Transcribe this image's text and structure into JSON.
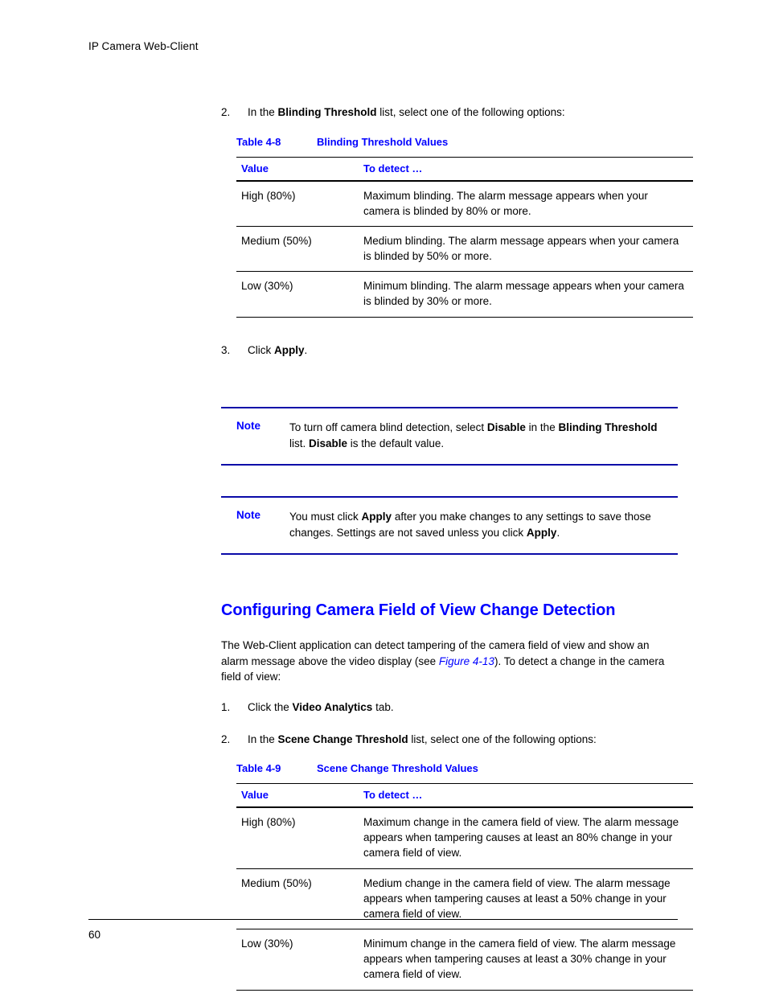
{
  "header": {
    "running_title": "IP Camera Web-Client"
  },
  "steps_top": {
    "step2_num": "2.",
    "step2_pre": "In the ",
    "step2_bold": "Blinding Threshold",
    "step2_post": " list, select one of the following options:",
    "step3_num": "3.",
    "step3_pre": "Click ",
    "step3_bold": "Apply",
    "step3_post": "."
  },
  "table_48": {
    "caption_number": "Table 4-8",
    "caption_title": "Blinding Threshold Values",
    "headers": [
      "Value",
      "To detect …"
    ],
    "rows": [
      {
        "value": "High (80%)",
        "detect": "Maximum blinding. The alarm message appears when your camera is blinded by 80% or more."
      },
      {
        "value": "Medium (50%)",
        "detect": "Medium blinding. The alarm message appears when your camera is blinded by 50% or more."
      },
      {
        "value": "Low (30%)",
        "detect": "Minimum blinding. The alarm message appears when your camera is blinded by 30% or more."
      }
    ]
  },
  "note1": {
    "label": "Note",
    "t1": "To turn off camera blind detection, select ",
    "b1": "Disable",
    "t2": " in the ",
    "b2": "Blinding Threshold",
    "t3": " list. ",
    "b3": "Disable",
    "t4": " is the default value."
  },
  "note2": {
    "label": "Note",
    "t1": "You must click ",
    "b1": "Apply",
    "t2": " after you make changes to any settings to save those changes. Settings are not saved unless you click ",
    "b2": "Apply",
    "t3": "."
  },
  "section": {
    "heading": "Configuring Camera Field of View Change Detection",
    "para_pre": "The Web-Client application can detect tampering of the camera field of view and show an alarm message above the video display (see ",
    "para_xref": "Figure 4-13",
    "para_post": "). To detect a change in the camera field of view:"
  },
  "steps_bottom": {
    "step1_num": "1.",
    "step1_pre": "Click the ",
    "step1_bold": "Video Analytics",
    "step1_post": " tab.",
    "step2_num": "2.",
    "step2_pre": "In the ",
    "step2_bold": "Scene Change Threshold",
    "step2_post": " list, select one of the following options:"
  },
  "table_49": {
    "caption_number": "Table 4-9",
    "caption_title": "Scene Change Threshold Values",
    "headers": [
      "Value",
      "To detect …"
    ],
    "rows": [
      {
        "value": "High (80%)",
        "detect": "Maximum change in the camera field of view. The alarm message appears when tampering causes at least an 80% change in your camera field of view."
      },
      {
        "value": "Medium (50%)",
        "detect": "Medium change in the camera field of view. The alarm message appears when tampering causes at least a 50% change in your camera field of view."
      },
      {
        "value": "Low (30%)",
        "detect": "Minimum change in the camera field of view. The alarm message appears when tampering causes at least a 30% change in your camera field of view."
      }
    ]
  },
  "footer": {
    "page_number": "60"
  },
  "colors": {
    "heading_blue": "#0000ff",
    "note_rule_blue": "#0a0aa8",
    "rule_black": "#000000"
  }
}
